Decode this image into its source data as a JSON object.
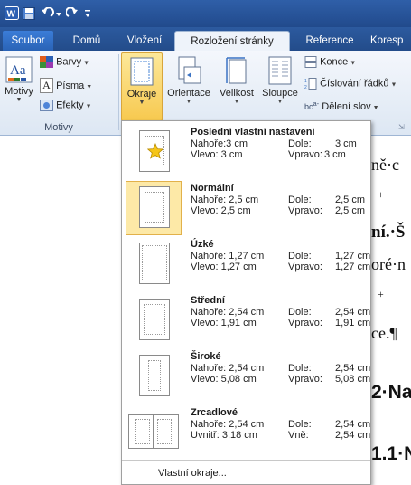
{
  "tabs": {
    "file": "Soubor",
    "home": "Domů",
    "insert": "Vložení",
    "layout": "Rozložení stránky",
    "references": "Reference",
    "mailings": "Koresp"
  },
  "ribbon": {
    "themes_group": {
      "label": "Motivy",
      "themes_button": "Motivy",
      "colors": "Barvy",
      "fonts": "Písma",
      "effects": "Efekty"
    },
    "margins": "Okraje",
    "orientation": "Orientace",
    "size": "Velikost",
    "columns": "Sloupce",
    "breaks": "Konce",
    "line_numbers": "Číslování řádků",
    "hyphenation": "Dělení slov"
  },
  "document": {
    "fragments": [
      "ně·c",
      "+",
      "ní.·Š",
      "oré·n",
      "+",
      "ce.¶",
      "2·Na",
      "1.1·N"
    ]
  },
  "margins_menu": {
    "items": [
      {
        "title": "Poslední vlastní nastavení",
        "l1": "Nahoře:",
        "v1": "3 cm",
        "l2": "Dole:",
        "v2": "3 cm",
        "l3": "Vlevo:",
        "v3": "3 cm",
        "l4": "Vpravo:",
        "v4": "3 cm"
      },
      {
        "title": "Normální",
        "l1": "Nahoře:",
        "v1": "2,5 cm",
        "l2": "Dole:",
        "v2": "2,5 cm",
        "l3": "Vlevo:",
        "v3": "2,5 cm",
        "l4": "Vpravo:",
        "v4": "2,5 cm"
      },
      {
        "title": "Úzké",
        "l1": "Nahoře:",
        "v1": "1,27 cm",
        "l2": "Dole:",
        "v2": "1,27 cm",
        "l3": "Vlevo:",
        "v3": "1,27 cm",
        "l4": "Vpravo:",
        "v4": "1,27 cm"
      },
      {
        "title": "Střední",
        "l1": "Nahoře:",
        "v1": "2,54 cm",
        "l2": "Dole:",
        "v2": "2,54 cm",
        "l3": "Vlevo:",
        "v3": "1,91 cm",
        "l4": "Vpravo:",
        "v4": "1,91 cm"
      },
      {
        "title": "Široké",
        "l1": "Nahoře:",
        "v1": "2,54 cm",
        "l2": "Dole:",
        "v2": "2,54 cm",
        "l3": "Vlevo:",
        "v3": "5,08 cm",
        "l4": "Vpravo:",
        "v4": "5,08 cm"
      },
      {
        "title": "Zrcadlové",
        "l1": "Nahoře:",
        "v1": "2,54 cm",
        "l2": "Dole:",
        "v2": "2,54 cm",
        "l3": "Uvnitř:",
        "v3": "3,18 cm",
        "l4": "Vně:",
        "v4": "2,54 cm"
      }
    ],
    "custom": "Vlastní okraje..."
  }
}
